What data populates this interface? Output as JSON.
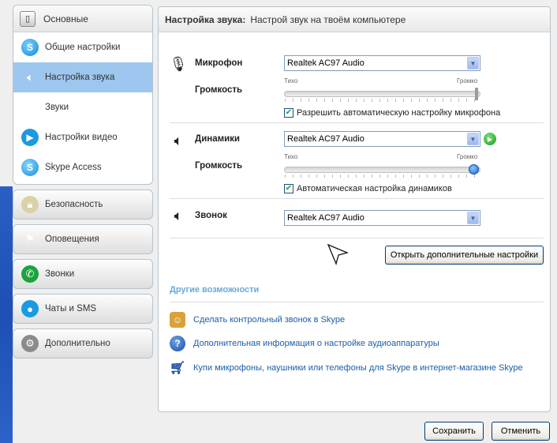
{
  "sidebar": {
    "group_main": {
      "label": "Основные",
      "icon": "gear-small-icon"
    },
    "items": [
      {
        "label": "Общие настройки",
        "icon": "skype-icon"
      },
      {
        "label": "Настройка звука",
        "icon": "sound-settings-icon"
      },
      {
        "label": "Звуки",
        "icon": "speaker-icon"
      },
      {
        "label": "Настройки видео",
        "icon": "video-icon"
      },
      {
        "label": "Skype Access",
        "icon": "skype-access-icon"
      }
    ],
    "categories": [
      {
        "label": "Безопасность",
        "icon": "lock-icon"
      },
      {
        "label": "Оповещения",
        "icon": "flag-icon"
      },
      {
        "label": "Звонки",
        "icon": "phone-icon"
      },
      {
        "label": "Чаты и SMS",
        "icon": "chat-icon"
      },
      {
        "label": "Дополнительно",
        "icon": "gear-icon"
      }
    ]
  },
  "panel": {
    "title": "Настройка звука:",
    "subtitle": "Настрой звук на твоём компьютере",
    "microphone": {
      "label": "Микрофон",
      "device": "Realtek AC97 Audio",
      "volume_label": "Громкость",
      "low_label": "Тихо",
      "high_label": "Громко",
      "volume_level": 1.0,
      "auto_checked": true,
      "auto_label": "Разрешить автоматическую настройку микрофона"
    },
    "speakers": {
      "label": "Динамики",
      "device": "Realtek AC97 Audio",
      "volume_label": "Громкость",
      "low_label": "Тихо",
      "high_label": "Громко",
      "volume_level": 1.0,
      "auto_checked": true,
      "auto_label": "Автоматическая настройка динамиков"
    },
    "ringer": {
      "label": "Звонок",
      "device": "Realtek AC97 Audio"
    },
    "advanced_button": "Открыть дополнительные настройки",
    "other_title": "Другие возможности",
    "links": [
      {
        "label": "Сделать контрольный звонок в Skype",
        "icon": "user-icon"
      },
      {
        "label": "Дополнительная информация о настройке аудиоаппаратуры",
        "icon": "help-icon"
      },
      {
        "label": "Купи микрофоны, наушники или телефоны для Skype в интернет-магазине Skype",
        "icon": "cart-icon"
      }
    ]
  },
  "footer": {
    "save_label": "Сохранить",
    "cancel_label": "Отменить"
  },
  "colors": {
    "active_item": "#9dc7ef",
    "link": "#1a5ea8",
    "section_title": "#6aa9d8"
  }
}
